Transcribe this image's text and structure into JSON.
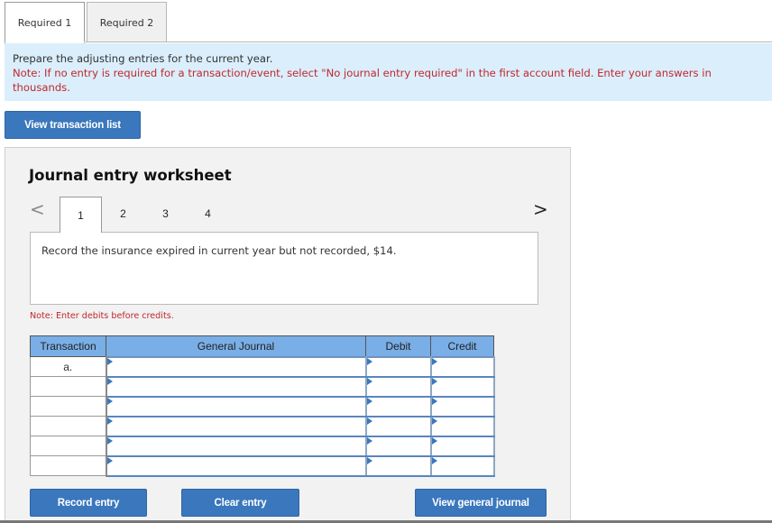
{
  "tabs": [
    {
      "label": "Required 1",
      "active": true
    },
    {
      "label": "Required 2",
      "active": false
    }
  ],
  "instructions": {
    "main": "Prepare the adjusting entries for the current year.",
    "note": "Note: If no entry is required for a transaction/event, select \"No journal entry required\" in the first account field. Enter your answers in thousands."
  },
  "buttons": {
    "view_transaction_list": "View transaction list",
    "record_entry": "Record entry",
    "clear_entry": "Clear entry",
    "view_general_journal": "View general journal"
  },
  "worksheet": {
    "title": "Journal entry worksheet",
    "prev_icon": "chevron-left-icon",
    "next_icon": "chevron-right-icon",
    "prev_glyph": "<",
    "next_glyph": ">",
    "steps": [
      "1",
      "2",
      "3",
      "4"
    ],
    "active_step": "1",
    "description": "Record the insurance expired in current year but not recorded, $14.",
    "debit_note": "Note: Enter debits before credits."
  },
  "journal_table": {
    "headers": {
      "transaction": "Transaction",
      "general_journal": "General Journal",
      "debit": "Debit",
      "credit": "Credit"
    },
    "rows": [
      {
        "transaction": "a.",
        "account": "",
        "debit": "",
        "credit": ""
      },
      {
        "transaction": "",
        "account": "",
        "debit": "",
        "credit": ""
      },
      {
        "transaction": "",
        "account": "",
        "debit": "",
        "credit": ""
      },
      {
        "transaction": "",
        "account": "",
        "debit": "",
        "credit": ""
      },
      {
        "transaction": "",
        "account": "",
        "debit": "",
        "credit": ""
      },
      {
        "transaction": "",
        "account": "",
        "debit": "",
        "credit": ""
      }
    ]
  },
  "colors": {
    "button_blue": "#3a77bd",
    "header_blue": "#7aaee6",
    "note_red": "#c0282e",
    "instruction_bg": "#dbeefb",
    "panel_bg": "#f2f2f2"
  }
}
